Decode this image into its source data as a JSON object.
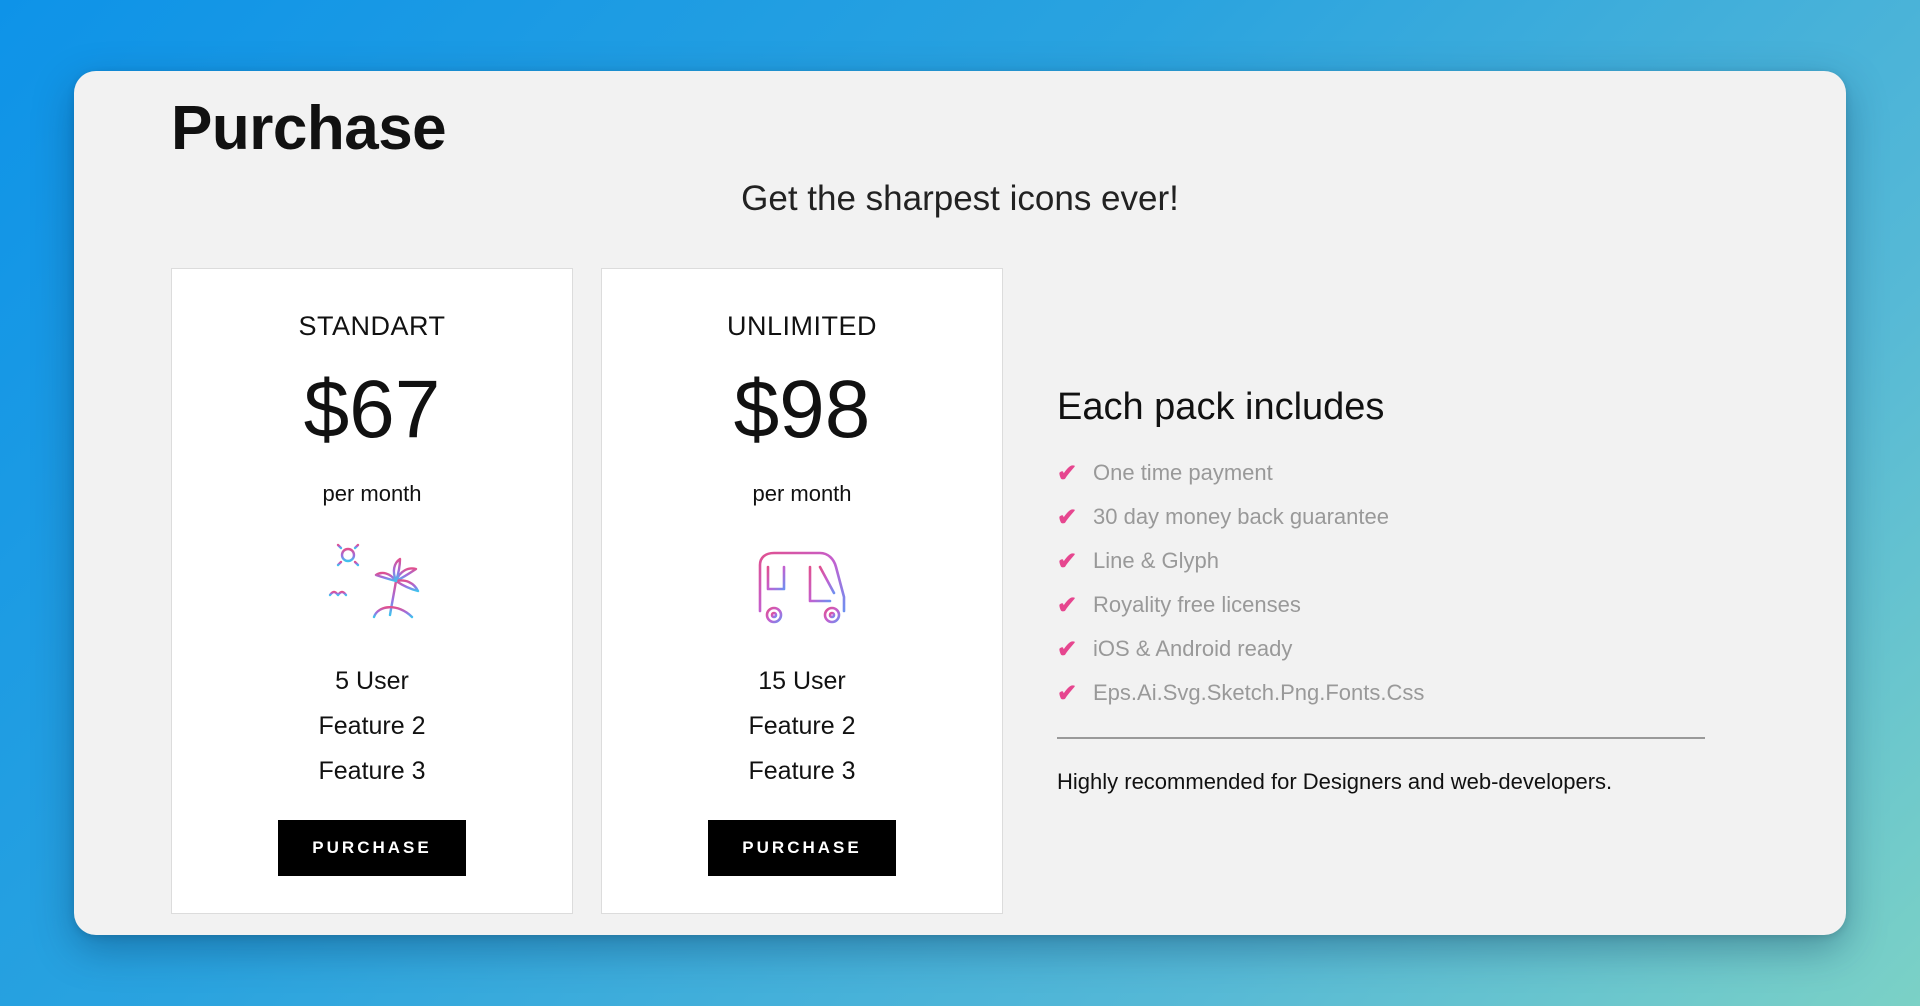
{
  "page": {
    "title": "Purchase",
    "subtitle": "Get the sharpest icons ever!"
  },
  "plans": [
    {
      "name": "STANDART",
      "price": "$67",
      "period": "per month",
      "icon": "beach-palm-icon",
      "features": [
        "5 User",
        "Feature 2",
        "Feature 3"
      ],
      "button_label": "PURCHASE"
    },
    {
      "name": "UNLIMITED",
      "price": "$98",
      "period": "per month",
      "icon": "tuk-tuk-icon",
      "features": [
        "15 User",
        "Feature 2",
        "Feature 3"
      ],
      "button_label": "PURCHASE"
    }
  ],
  "includes": {
    "title": "Each pack includes",
    "items": [
      "One time payment",
      "30 day money back guarantee",
      "Line & Glyph",
      "Royality free licenses",
      "iOS & Android ready",
      "Eps.Ai.Svg.Sketch.Png.Fonts.Css"
    ],
    "check_icon": "check-icon",
    "note": "Highly recommended for Designers and web-developers."
  },
  "colors": {
    "accent": "#e6468f",
    "button": "#000000",
    "card_background": "#ffffff",
    "window_background": "#f2f2f2",
    "muted_text": "#999999"
  }
}
